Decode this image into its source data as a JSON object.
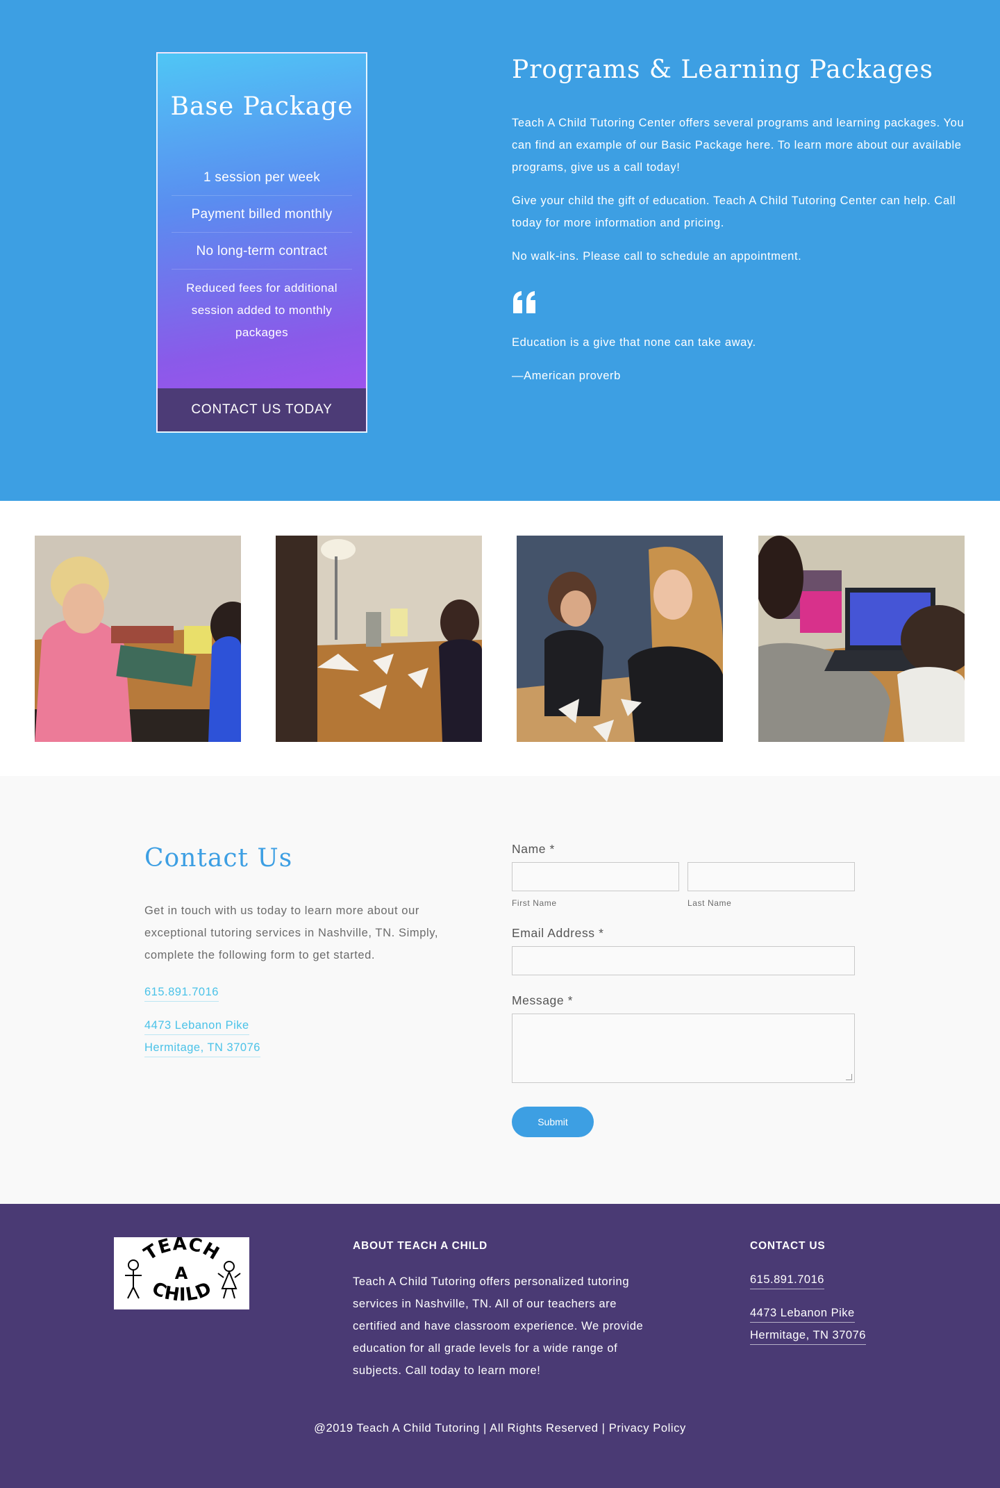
{
  "package": {
    "title": "Base Package",
    "features": [
      "1 session per week",
      "Payment billed monthly",
      "No long-term contract"
    ],
    "note": "Reduced fees for additional session added to monthly packages",
    "cta_label": "CONTACT US TODAY"
  },
  "programs": {
    "title": "Programs & Learning Packages",
    "paragraphs": [
      "Teach A Child Tutoring Center offers several programs and learning packages. You can find an example of our Basic Package here. To learn more about our available programs, give us a call today!",
      "Give your child the gift of education. Teach A Child Tutoring Center can help. Call today for more information and pricing.",
      "No walk-ins. Please call to schedule an appointment."
    ],
    "quote_icon": "quote-icon",
    "quote": "Education is a give that none can take away.",
    "quote_author": "—American proverb"
  },
  "photos": {
    "items": [
      "tutoring-photo-1",
      "tutoring-photo-2",
      "tutoring-photo-3",
      "tutoring-photo-4"
    ]
  },
  "contact": {
    "title": "Contact Us",
    "intro": "Get in touch with us today to learn more about our exceptional tutoring services in Nashville, TN. Simply, complete the following form to get started.",
    "phone": "615.891.7016",
    "address_line1": "4473 Lebanon Pike",
    "address_line2": "Hermitage, TN 37076"
  },
  "form": {
    "name_label": "Name *",
    "first_name_label": "First Name",
    "last_name_label": "Last Name",
    "email_label": "Email Address *",
    "message_label": "Message *",
    "submit_label": "Submit"
  },
  "footer": {
    "about_heading": "ABOUT TEACH A CHILD",
    "about_text": "Teach A Child Tutoring offers personalized tutoring services in Nashville, TN. All of our teachers are certified and have classroom experience. We provide education for all grade levels for a wide range of subjects. Call today to learn more!",
    "contact_heading": "CONTACT US",
    "phone": "615.891.7016",
    "address_line1": "4473 Lebanon Pike",
    "address_line2": "Hermitage, TN 37076",
    "copyright": "@2019 Teach A Child Tutoring | All Rights Reserved | Privacy Policy",
    "logo": {
      "word1": "TEACH",
      "word2": "A",
      "word3": "CHILD"
    }
  },
  "colors": {
    "hero_blue": "#3d9fe3",
    "footer_purple": "#4a3a74",
    "cta_purple": "#4c3b76",
    "link_cyan": "#4ac2e8"
  }
}
